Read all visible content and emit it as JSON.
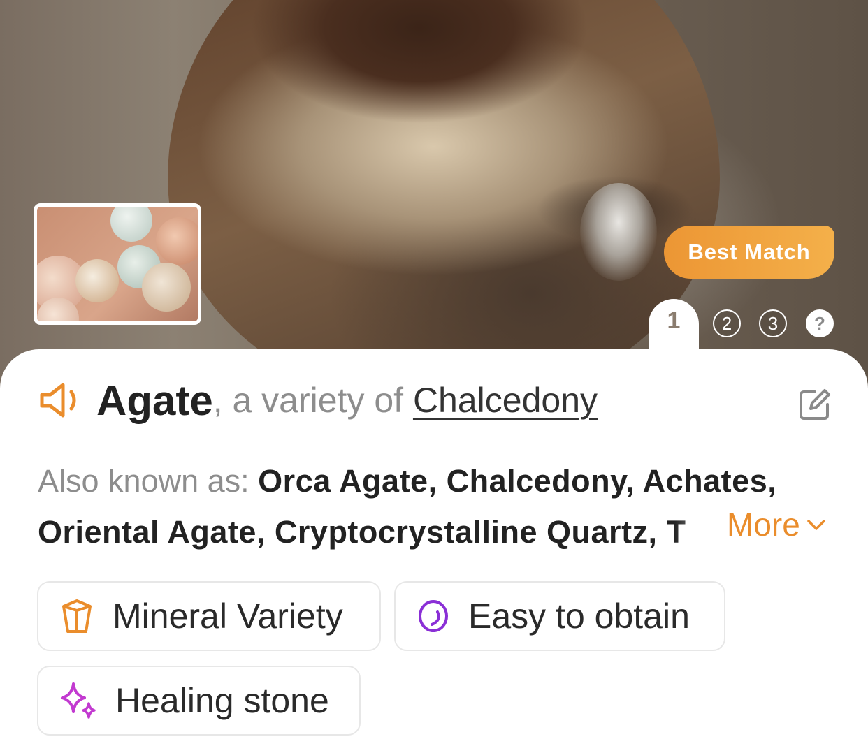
{
  "hero": {
    "badge": "Best Match",
    "pages": [
      "1",
      "2",
      "3",
      "?"
    ]
  },
  "result": {
    "name": "Agate",
    "variety_prefix": ", a variety of ",
    "parent": "Chalcedony",
    "aka_label": "Also known as: ",
    "aka_line1": "Orca Agate, Chalcedony, Achates,",
    "aka_line2": "Oriental Agate, Cryptocrystalline Quartz, T",
    "more_label": "More"
  },
  "tags": [
    {
      "label": "Mineral Variety",
      "icon": "gem-icon",
      "color": "#ea8d2c"
    },
    {
      "label": "Easy to obtain",
      "icon": "stone-icon",
      "color": "#8a2fd6"
    },
    {
      "label": "Healing stone",
      "icon": "sparkle-icon",
      "color": "#c23ad0"
    }
  ],
  "colors": {
    "accent": "#ea8d2c",
    "badge_gradient": [
      "#ec9634",
      "#f4b04a"
    ]
  }
}
